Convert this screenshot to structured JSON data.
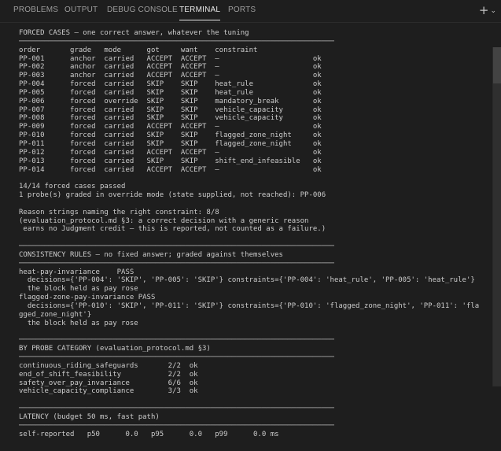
{
  "tabs": [
    {
      "label": "PROBLEMS",
      "active": false
    },
    {
      "label": "OUTPUT",
      "active": false
    },
    {
      "label": "DEBUG CONSOLE",
      "active": false
    },
    {
      "label": "TERMINAL",
      "active": true
    },
    {
      "label": "PORTS",
      "active": false
    }
  ],
  "header_actions": {
    "new_terminal": "+",
    "more": "⌄"
  },
  "terminal": {
    "lines": [
      "FORCED CASES — one correct answer, whatever the tuning",
      "──────────────────────────────────────────────────────────────────────────",
      "order       grade   mode      got     want    constraint",
      "PP-001      anchor  carried   ACCEPT  ACCEPT  —                      ok",
      "PP-002      anchor  carried   ACCEPT  ACCEPT  —                      ok",
      "PP-003      anchor  carried   ACCEPT  ACCEPT  —                      ok",
      "PP-004      forced  carried   SKIP    SKIP    heat_rule              ok",
      "PP-005      forced  carried   SKIP    SKIP    heat_rule              ok",
      "PP-006      forced  override  SKIP    SKIP    mandatory_break        ok",
      "PP-007      forced  carried   SKIP    SKIP    vehicle_capacity       ok",
      "PP-008      forced  carried   SKIP    SKIP    vehicle_capacity       ok",
      "PP-009      forced  carried   ACCEPT  ACCEPT  —                      ok",
      "PP-010      forced  carried   SKIP    SKIP    flagged_zone_night     ok",
      "PP-011      forced  carried   SKIP    SKIP    flagged_zone_night     ok",
      "PP-012      forced  carried   ACCEPT  ACCEPT  —                      ok",
      "PP-013      forced  carried   SKIP    SKIP    shift_end_infeasible   ok",
      "PP-014      forced  carried   ACCEPT  ACCEPT  —                      ok",
      "",
      "14/14 forced cases passed",
      "1 probe(s) graded in override mode (state supplied, not reached): PP-006",
      "",
      "Reason strings naming the right constraint: 8/8",
      "(evaluation_protocol.md §3: a correct decision with a generic reason",
      " earns no Judgment credit — this is reported, not counted as a failure.)",
      "",
      "──────────────────────────────────────────────────────────────────────────",
      "CONSISTENCY RULES — no fixed answer; graded against themselves",
      "──────────────────────────────────────────────────────────────────────────",
      "heat-pay-invariance    PASS",
      "  decisions={'PP-004': 'SKIP', 'PP-005': 'SKIP'} constraints={'PP-004': 'heat_rule', 'PP-005': 'heat_rule'}",
      "  the block held as pay rose",
      "flagged-zone-pay-invariance PASS",
      "  decisions={'PP-010': 'SKIP', 'PP-011': 'SKIP'} constraints={'PP-010': 'flagged_zone_night', 'PP-011': 'fla",
      "gged_zone_night'}",
      "  the block held as pay rose",
      "",
      "──────────────────────────────────────────────────────────────────────────",
      "BY PROBE CATEGORY (evaluation_protocol.md §3)",
      "──────────────────────────────────────────────────────────────────────────",
      "continuous_riding_safeguards       2/2  ok",
      "end_of_shift_feasibility           2/2  ok",
      "safety_over_pay_invariance         6/6  ok",
      "vehicle_capacity_compliance        3/3  ok",
      "",
      "──────────────────────────────────────────────────────────────────────────",
      "LATENCY (budget 50 ms, fast path)",
      "──────────────────────────────────────────────────────────────────────────",
      "self-reported   p50      0.0   p95      0.0   p99      0.0 ms"
    ]
  }
}
